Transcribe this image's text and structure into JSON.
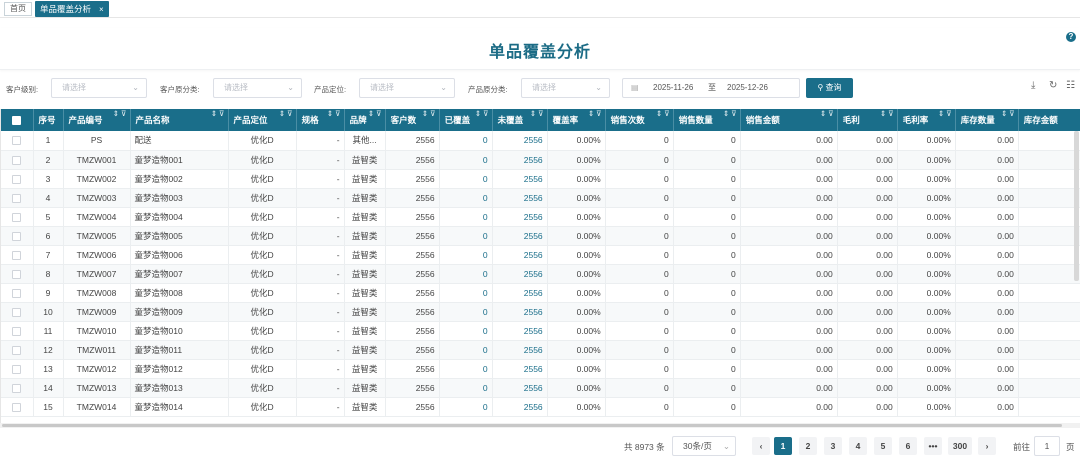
{
  "tabs": {
    "home": "首页",
    "active": "单品覆盖分析",
    "close": "×"
  },
  "title": "单品覆盖分析",
  "help": "?",
  "filters": [
    {
      "label": "客户级别:",
      "placeholder": "请选择"
    },
    {
      "label": "客户原分类:",
      "placeholder": "请选择"
    },
    {
      "label": "产品定位:",
      "placeholder": "请选择"
    },
    {
      "label": "产品原分类:",
      "placeholder": "请选择"
    }
  ],
  "date": {
    "start": "2025-11-26",
    "sep": "至",
    "end": "2025-12-26"
  },
  "query_label": "查询",
  "columns": [
    "序号",
    "产品编号",
    "产品名称",
    "产品定位",
    "规格",
    "品牌",
    "客户数",
    "已覆盖",
    "未覆盖",
    "覆盖率",
    "销售次数",
    "销售数量",
    "销售金额",
    "毛利",
    "毛利率",
    "库存数量",
    "库存金额"
  ],
  "rows": [
    [
      "1",
      "PS",
      "配送",
      "优化D",
      "-",
      "其他...",
      "2556",
      "0",
      "2556",
      "0.00%",
      "0",
      "0",
      "0.00",
      "0.00",
      "0.00%",
      "0.00"
    ],
    [
      "2",
      "TMZW001",
      "童梦造物001",
      "优化D",
      "-",
      "益智类",
      "2556",
      "0",
      "2556",
      "0.00%",
      "0",
      "0",
      "0.00",
      "0.00",
      "0.00%",
      "0.00"
    ],
    [
      "3",
      "TMZW002",
      "童梦造物002",
      "优化D",
      "-",
      "益智类",
      "2556",
      "0",
      "2556",
      "0.00%",
      "0",
      "0",
      "0.00",
      "0.00",
      "0.00%",
      "0.00"
    ],
    [
      "4",
      "TMZW003",
      "童梦造物003",
      "优化D",
      "-",
      "益智类",
      "2556",
      "0",
      "2556",
      "0.00%",
      "0",
      "0",
      "0.00",
      "0.00",
      "0.00%",
      "0.00"
    ],
    [
      "5",
      "TMZW004",
      "童梦造物004",
      "优化D",
      "-",
      "益智类",
      "2556",
      "0",
      "2556",
      "0.00%",
      "0",
      "0",
      "0.00",
      "0.00",
      "0.00%",
      "0.00"
    ],
    [
      "6",
      "TMZW005",
      "童梦造物005",
      "优化D",
      "-",
      "益智类",
      "2556",
      "0",
      "2556",
      "0.00%",
      "0",
      "0",
      "0.00",
      "0.00",
      "0.00%",
      "0.00"
    ],
    [
      "7",
      "TMZW006",
      "童梦造物006",
      "优化D",
      "-",
      "益智类",
      "2556",
      "0",
      "2556",
      "0.00%",
      "0",
      "0",
      "0.00",
      "0.00",
      "0.00%",
      "0.00"
    ],
    [
      "8",
      "TMZW007",
      "童梦造物007",
      "优化D",
      "-",
      "益智类",
      "2556",
      "0",
      "2556",
      "0.00%",
      "0",
      "0",
      "0.00",
      "0.00",
      "0.00%",
      "0.00"
    ],
    [
      "9",
      "TMZW008",
      "童梦造物008",
      "优化D",
      "-",
      "益智类",
      "2556",
      "0",
      "2556",
      "0.00%",
      "0",
      "0",
      "0.00",
      "0.00",
      "0.00%",
      "0.00"
    ],
    [
      "10",
      "TMZW009",
      "童梦造物009",
      "优化D",
      "-",
      "益智类",
      "2556",
      "0",
      "2556",
      "0.00%",
      "0",
      "0",
      "0.00",
      "0.00",
      "0.00%",
      "0.00"
    ],
    [
      "11",
      "TMZW010",
      "童梦造物010",
      "优化D",
      "-",
      "益智类",
      "2556",
      "0",
      "2556",
      "0.00%",
      "0",
      "0",
      "0.00",
      "0.00",
      "0.00%",
      "0.00"
    ],
    [
      "12",
      "TMZW011",
      "童梦造物011",
      "优化D",
      "-",
      "益智类",
      "2556",
      "0",
      "2556",
      "0.00%",
      "0",
      "0",
      "0.00",
      "0.00",
      "0.00%",
      "0.00"
    ],
    [
      "13",
      "TMZW012",
      "童梦造物012",
      "优化D",
      "-",
      "益智类",
      "2556",
      "0",
      "2556",
      "0.00%",
      "0",
      "0",
      "0.00",
      "0.00",
      "0.00%",
      "0.00"
    ],
    [
      "14",
      "TMZW013",
      "童梦造物013",
      "优化D",
      "-",
      "益智类",
      "2556",
      "0",
      "2556",
      "0.00%",
      "0",
      "0",
      "0.00",
      "0.00",
      "0.00%",
      "0.00"
    ],
    [
      "15",
      "TMZW014",
      "童梦造物014",
      "优化D",
      "-",
      "益智类",
      "2556",
      "0",
      "2556",
      "0.00%",
      "0",
      "0",
      "0.00",
      "0.00",
      "0.00%",
      "0.00"
    ]
  ],
  "pager": {
    "total": "共 8973 条",
    "size": "30条/页",
    "prev": "‹",
    "pages": [
      "1",
      "2",
      "3",
      "4",
      "5",
      "6",
      "•••",
      "300"
    ],
    "next": "›",
    "goto": "前往",
    "goto_value": "1",
    "goto_suffix": "页"
  }
}
